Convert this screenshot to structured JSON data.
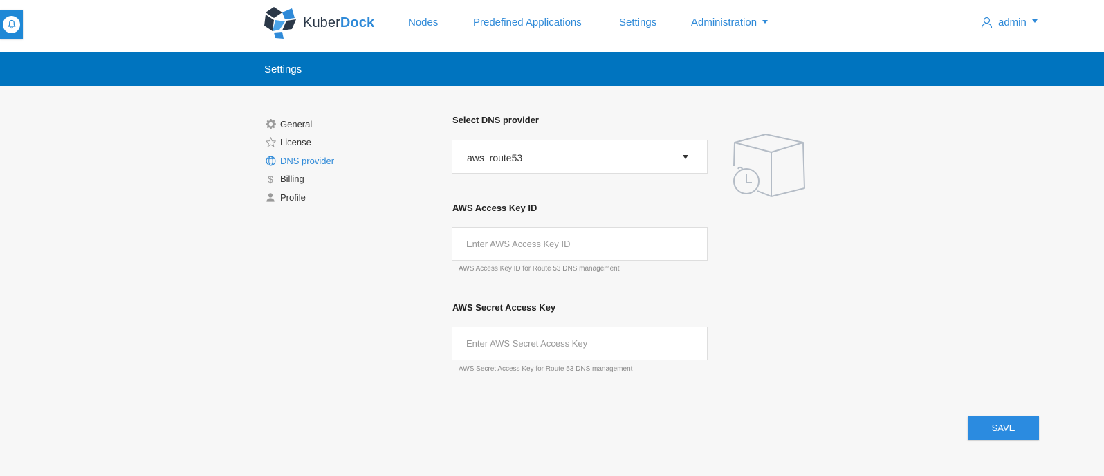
{
  "header": {
    "logo_part1": "Kuber",
    "logo_part2": "Dock",
    "nav": [
      {
        "label": "Nodes"
      },
      {
        "label": "Predefined Applications"
      },
      {
        "label": "Settings"
      },
      {
        "label": "Administration"
      }
    ],
    "user": "admin"
  },
  "band": {
    "title": "Settings"
  },
  "sidebar": {
    "items": [
      {
        "label": "General",
        "icon": "gear-icon"
      },
      {
        "label": "License",
        "icon": "star-icon"
      },
      {
        "label": "DNS provider",
        "icon": "globe-icon",
        "active": true
      },
      {
        "label": "Billing",
        "icon": "dollar-icon"
      },
      {
        "label": "Profile",
        "icon": "user-icon"
      }
    ]
  },
  "form": {
    "dns_label": "Select DNS provider",
    "dns_value": "aws_route53",
    "key_id_label": "AWS Access Key ID",
    "key_id_placeholder": "Enter AWS Access Key ID",
    "key_id_help": "AWS Access Key ID for Route 53 DNS management",
    "secret_label": "AWS Secret Access Key",
    "secret_placeholder": "Enter AWS Secret Access Key",
    "secret_help": "AWS Secret Access Key for Route 53 DNS management",
    "save_label": "SAVE"
  },
  "colors": {
    "accent": "#2f8ad8",
    "band": "#0074bf",
    "save_button": "#2b8be0"
  }
}
